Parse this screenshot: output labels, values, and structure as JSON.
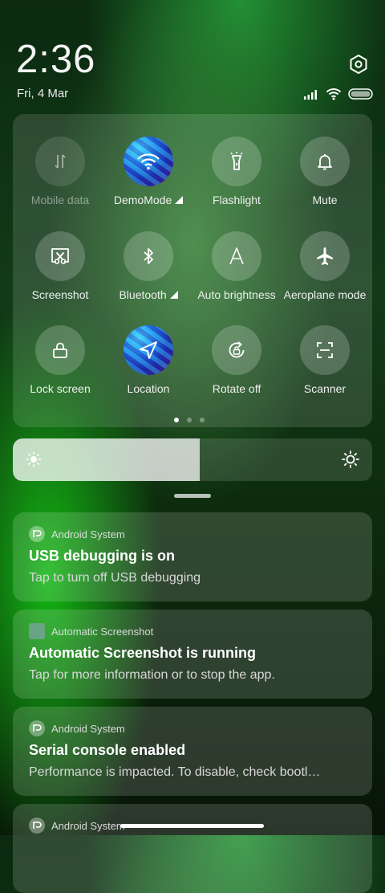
{
  "status_bar": {
    "time": "2:36",
    "date": "Fri, 4 Mar",
    "icons": [
      "signal-icon",
      "wifi-icon",
      "battery-icon"
    ]
  },
  "tiles": [
    {
      "label": "Mobile data",
      "icon": "mobile-data-icon",
      "state": "disabled"
    },
    {
      "label": "DemoMode",
      "icon": "wifi-icon",
      "state": "active",
      "expandable": true
    },
    {
      "label": "Flashlight",
      "icon": "flashlight-icon",
      "state": "off"
    },
    {
      "label": "Mute",
      "icon": "bell-icon",
      "state": "off"
    },
    {
      "label": "Screenshot",
      "icon": "scissors-icon",
      "state": "off"
    },
    {
      "label": "Bluetooth",
      "icon": "bluetooth-icon",
      "state": "off",
      "expandable": true
    },
    {
      "label": "Auto brightness",
      "icon": "auto-brightness-icon",
      "state": "off"
    },
    {
      "label": "Aeroplane mode",
      "icon": "airplane-icon",
      "state": "off"
    },
    {
      "label": "Lock screen",
      "icon": "lock-icon",
      "state": "off"
    },
    {
      "label": "Location",
      "icon": "location-arrow-icon",
      "state": "active"
    },
    {
      "label": "Rotate off",
      "icon": "rotate-lock-icon",
      "state": "off"
    },
    {
      "label": "Scanner",
      "icon": "scanner-icon",
      "state": "off"
    }
  ],
  "pager": {
    "pages": 3,
    "current": 1
  },
  "brightness": {
    "level": 0.52
  },
  "notifications": [
    {
      "app": "Android System",
      "icon": "android-system-icon",
      "title": "USB debugging is on",
      "body": "Tap to turn off USB debugging"
    },
    {
      "app": "Automatic Screenshot",
      "icon": "automatic-screenshot-app-icon",
      "title": "Automatic Screenshot is running",
      "body": "Tap for more information or to stop the app."
    },
    {
      "app": "Android System",
      "icon": "android-system-icon",
      "title": "Serial console enabled",
      "body": "Performance is impacted. To disable, check bootl…"
    },
    {
      "app": "Android System",
      "icon": "android-system-icon",
      "title": "",
      "body": ""
    }
  ]
}
